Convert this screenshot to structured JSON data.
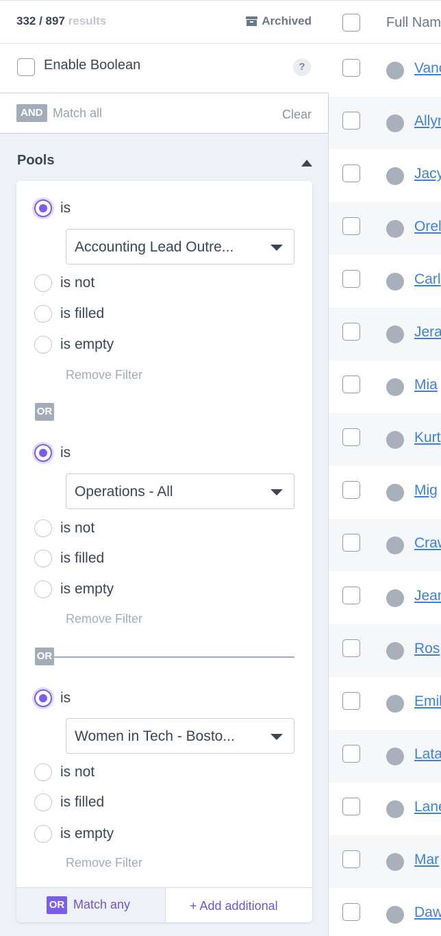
{
  "header": {
    "result_count": "332 / 897",
    "results_word": "results",
    "archived_label": "Archived"
  },
  "boolean": {
    "label": "Enable Boolean",
    "help": "?"
  },
  "match": {
    "badge": "AND",
    "label": "Match all",
    "clear": "Clear"
  },
  "pools": {
    "title": "Pools",
    "or_label": "OR",
    "remove_label": "Remove Filter",
    "options": {
      "is": "is",
      "is_not": "is not",
      "is_filled": "is filled",
      "is_empty": "is empty"
    },
    "filters": [
      {
        "selected": "is",
        "value": "Accounting Lead Outre..."
      },
      {
        "selected": "is",
        "value": "Operations - All"
      },
      {
        "selected": "is",
        "value": "Women in Tech - Bosto..."
      }
    ],
    "footer": {
      "badge": "OR",
      "match_any": "Match any",
      "add_additional": "+ Add additional"
    }
  },
  "table": {
    "column_header": "Full Name",
    "rows": [
      "Vance",
      "Allyn",
      "Jacy",
      "Orel",
      "Carl",
      "Jera",
      "Mia",
      "Kurt",
      "Mig",
      "Craw",
      "Jean",
      "Ros",
      "Emil",
      "Lata",
      "Lane",
      "Mar",
      "Dawn"
    ]
  }
}
